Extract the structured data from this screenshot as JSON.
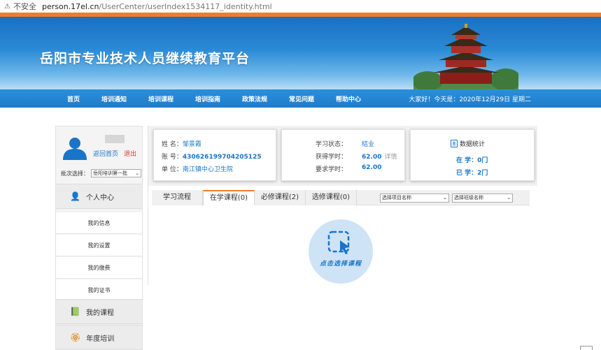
{
  "browser": {
    "security_label": "不安全",
    "url_domain": "person.17el.cn",
    "url_path": "/UserCenter/userIndex1534117_identity.html"
  },
  "banner": {
    "title": "岳阳市专业技术人员继续教育平台"
  },
  "nav": {
    "items": [
      "首页",
      "培训通知",
      "培训课程",
      "培训指南",
      "政策法规",
      "常见问题",
      "帮助中心"
    ],
    "greeting": "大家好！今天是：2020年12月29日 星期二"
  },
  "sidebar": {
    "home_link": "返回首页",
    "exit_link": "退出",
    "batch_label": "批次选择：",
    "batch_value": "岳阳培训第一批",
    "personal_center": "个人中心",
    "menu": [
      "我的信息",
      "我的设置",
      "我的缴费",
      "我的证书"
    ],
    "my_courses": "我的课程",
    "annual_training": "年度培训"
  },
  "profile": {
    "name_label": "姓  名：",
    "name_value": "邹景霞",
    "id_label": "账  号：",
    "id_value": "430626199704205125",
    "unit_label": "单  位：",
    "unit_value": "南江镇中心卫生院"
  },
  "study": {
    "status_label": "学习状态：",
    "status_value": "结业",
    "earned_label": "获得学时：",
    "earned_value": "62.00",
    "detail_link": "详情",
    "required_label": "要求学时：",
    "required_value": "62.00"
  },
  "stats": {
    "title": "数据统计",
    "in_study": "在  学：0门",
    "completed": "已  学：2门"
  },
  "tabs": {
    "items": [
      "学习流程",
      "在学课程(0)",
      "必修课程(2)",
      "选修课程(0)"
    ],
    "active_index": 1,
    "project_select": "选择项目名称",
    "class_select": "选择班级名称"
  },
  "empty_state": {
    "caption": "点击选择课程"
  },
  "colors": {
    "primary": "#1a74c8",
    "accent": "#ef7d2a",
    "nav": "#2187d3"
  }
}
